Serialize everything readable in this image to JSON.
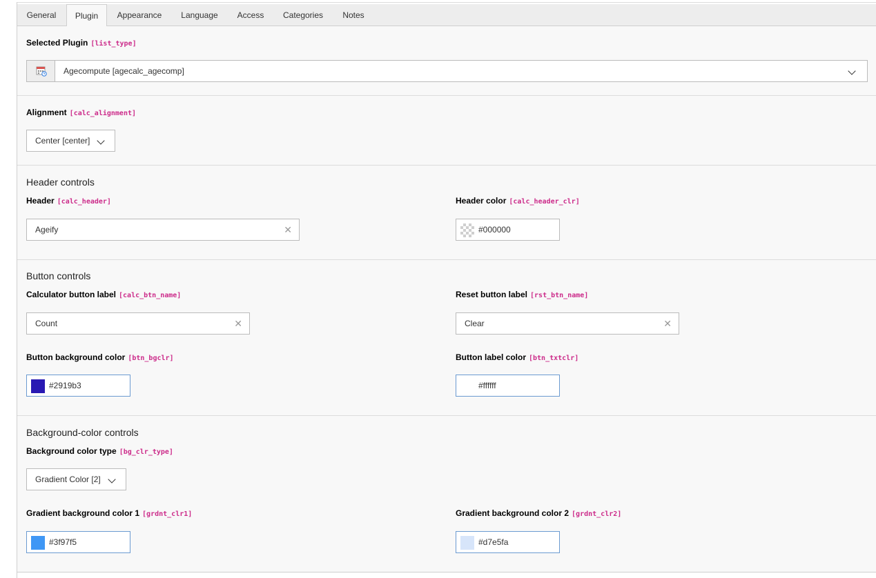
{
  "tabs": [
    "General",
    "Plugin",
    "Appearance",
    "Language",
    "Access",
    "Categories",
    "Notes"
  ],
  "active_tab": "Plugin",
  "plugin": {
    "label": "Selected Plugin",
    "code": "[list_type]",
    "value": "Agecompute [agecalc_agecomp]",
    "icon": "calendar-plugin-icon"
  },
  "alignment": {
    "label": "Alignment",
    "code": "[calc_alignment]",
    "value": "Center [center]"
  },
  "header_controls": {
    "heading": "Header controls",
    "header": {
      "label": "Header",
      "code": "[calc_header]",
      "value": "Ageify"
    },
    "header_color": {
      "label": "Header color",
      "code": "[calc_header_clr]",
      "value": "#000000",
      "swatch": "transparent"
    }
  },
  "button_controls": {
    "heading": "Button controls",
    "calc_btn": {
      "label": "Calculator button label",
      "code": "[calc_btn_name]",
      "value": "Count"
    },
    "reset_btn": {
      "label": "Reset button label",
      "code": "[rst_btn_name]",
      "value": "Clear"
    },
    "btn_bg": {
      "label": "Button background color",
      "code": "[btn_bgclr]",
      "value": "#2919b3",
      "swatch": "#2919b3"
    },
    "btn_txt": {
      "label": "Button label color",
      "code": "[btn_txtclr]",
      "value": "#ffffff",
      "swatch": "#ffffff"
    }
  },
  "bg_controls": {
    "heading": "Background-color controls",
    "type": {
      "label": "Background color type",
      "code": "[bg_clr_type]",
      "value": "Gradient Color [2]"
    },
    "grad1": {
      "label": "Gradient background color 1",
      "code": "[grdnt_clr1]",
      "value": "#3f97f5",
      "swatch": "#3f97f5"
    },
    "grad2": {
      "label": "Gradient background color 2",
      "code": "[grdnt_clr2]",
      "value": "#d7e5fa",
      "swatch": "#d7e5fa"
    }
  },
  "colors": {
    "code_accent": "#cc2b8a",
    "focus_border": "#6a9ad1"
  }
}
